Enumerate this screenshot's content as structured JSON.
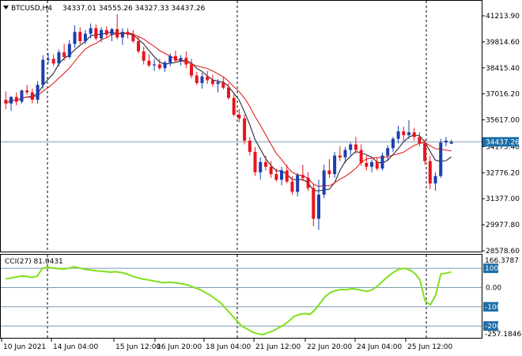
{
  "header": {
    "symbol_timeframe": "BTCUSD,H4",
    "ohlc": "34337.01 34555.26 34327.33 34437.26"
  },
  "cci_panel": {
    "label": "CCI(27) 81.0431",
    "upper_value": "166.3787",
    "lower_value": "-257.1846",
    "level_100": "100",
    "level_0": "0.00",
    "level_m100": "-100",
    "level_m200": "-200"
  },
  "price_axis": {
    "ticks": [
      "41213.90",
      "39814.60",
      "38415.40",
      "37016.20",
      "35617.00",
      "34175.40",
      "32776.20",
      "31377.00",
      "29977.80",
      "28578.60"
    ],
    "current_price_tag": "34437.26"
  },
  "time_axis": {
    "labels": [
      "10 Jun 2021",
      "14 Jun 04:00",
      "15 Jun 12:00",
      "16 Jun 20:00",
      "18 Jun 04:00",
      "21 Jun 12:00",
      "22 Jun 20:00",
      "24 Jun 04:00",
      "25 Jun 12:00"
    ]
  },
  "colors": {
    "bull": "#1a3fae",
    "bear": "#e8141e",
    "band_upper_red": "#e00010",
    "band_lower_blue": "#1010d0",
    "ma_black": "#101828",
    "ma_red": "#e01010",
    "cci_line": "#7fe01a",
    "grid_dash": "#000000",
    "level_line": "#7a9bb5",
    "price_line": "#7a9bb5",
    "tag_bg": "#1a6ea8"
  },
  "chart_data": {
    "type": "candlestick",
    "title": "BTCUSD,H4",
    "ylim": [
      28578.6,
      41213.9
    ],
    "candles": [
      {
        "o": 36700,
        "h": 37150,
        "l": 36200,
        "c": 36500
      },
      {
        "o": 36500,
        "h": 36900,
        "l": 36100,
        "c": 36850
      },
      {
        "o": 36850,
        "h": 37100,
        "l": 36400,
        "c": 36600
      },
      {
        "o": 36600,
        "h": 37250,
        "l": 36500,
        "c": 37200
      },
      {
        "o": 37200,
        "h": 37500,
        "l": 36950,
        "c": 37100
      },
      {
        "o": 37100,
        "h": 37300,
        "l": 36500,
        "c": 36700
      },
      {
        "o": 36700,
        "h": 37700,
        "l": 36500,
        "c": 37500
      },
      {
        "o": 37500,
        "h": 39100,
        "l": 37300,
        "c": 38850
      },
      {
        "o": 38850,
        "h": 39200,
        "l": 38650,
        "c": 38900
      },
      {
        "o": 38900,
        "h": 39150,
        "l": 38500,
        "c": 38650
      },
      {
        "o": 38650,
        "h": 39400,
        "l": 38500,
        "c": 39250
      },
      {
        "o": 39250,
        "h": 39700,
        "l": 38800,
        "c": 39000
      },
      {
        "o": 39000,
        "h": 39900,
        "l": 38900,
        "c": 39700
      },
      {
        "o": 39700,
        "h": 40700,
        "l": 39500,
        "c": 40350
      },
      {
        "o": 40350,
        "h": 40600,
        "l": 39700,
        "c": 39850
      },
      {
        "o": 39850,
        "h": 40450,
        "l": 39700,
        "c": 40250
      },
      {
        "o": 40250,
        "h": 40800,
        "l": 40000,
        "c": 40550
      },
      {
        "o": 40550,
        "h": 40750,
        "l": 39900,
        "c": 40000
      },
      {
        "o": 40000,
        "h": 40600,
        "l": 39800,
        "c": 40450
      },
      {
        "o": 40450,
        "h": 40650,
        "l": 40050,
        "c": 40200
      },
      {
        "o": 40200,
        "h": 40550,
        "l": 39850,
        "c": 40500
      },
      {
        "o": 40500,
        "h": 41300,
        "l": 39950,
        "c": 40050
      },
      {
        "o": 40050,
        "h": 40550,
        "l": 39650,
        "c": 40350
      },
      {
        "o": 40350,
        "h": 40550,
        "l": 40000,
        "c": 40200
      },
      {
        "o": 40200,
        "h": 40450,
        "l": 39750,
        "c": 39850
      },
      {
        "o": 39850,
        "h": 40150,
        "l": 39200,
        "c": 39300
      },
      {
        "o": 39300,
        "h": 39550,
        "l": 38600,
        "c": 38800
      },
      {
        "o": 38800,
        "h": 39150,
        "l": 38450,
        "c": 38550
      },
      {
        "o": 38550,
        "h": 38900,
        "l": 38250,
        "c": 38600
      },
      {
        "o": 38600,
        "h": 38900,
        "l": 38300,
        "c": 38400
      },
      {
        "o": 38400,
        "h": 38800,
        "l": 38200,
        "c": 38700
      },
      {
        "o": 38700,
        "h": 39200,
        "l": 38500,
        "c": 39050
      },
      {
        "o": 39050,
        "h": 39350,
        "l": 38700,
        "c": 38800
      },
      {
        "o": 38800,
        "h": 39100,
        "l": 38550,
        "c": 38950
      },
      {
        "o": 38950,
        "h": 39300,
        "l": 38400,
        "c": 38600
      },
      {
        "o": 38600,
        "h": 38900,
        "l": 37850,
        "c": 38000
      },
      {
        "o": 38000,
        "h": 38200,
        "l": 37500,
        "c": 37600
      },
      {
        "o": 37600,
        "h": 38150,
        "l": 37300,
        "c": 37950
      },
      {
        "o": 37950,
        "h": 38250,
        "l": 37550,
        "c": 37750
      },
      {
        "o": 37750,
        "h": 38050,
        "l": 37400,
        "c": 37550
      },
      {
        "o": 37550,
        "h": 37800,
        "l": 37100,
        "c": 37650
      },
      {
        "o": 37650,
        "h": 37950,
        "l": 37250,
        "c": 37350
      },
      {
        "o": 37350,
        "h": 37600,
        "l": 36700,
        "c": 36800
      },
      {
        "o": 36800,
        "h": 37000,
        "l": 35800,
        "c": 35900
      },
      {
        "o": 35900,
        "h": 36200,
        "l": 35500,
        "c": 35700
      },
      {
        "o": 35700,
        "h": 35900,
        "l": 34300,
        "c": 34500
      },
      {
        "o": 34500,
        "h": 34700,
        "l": 33700,
        "c": 33900
      },
      {
        "o": 33900,
        "h": 34150,
        "l": 32600,
        "c": 32800
      },
      {
        "o": 32800,
        "h": 33600,
        "l": 32400,
        "c": 33350
      },
      {
        "o": 33350,
        "h": 33700,
        "l": 32900,
        "c": 33100
      },
      {
        "o": 33100,
        "h": 33400,
        "l": 32500,
        "c": 32700
      },
      {
        "o": 32700,
        "h": 33000,
        "l": 32300,
        "c": 32400
      },
      {
        "o": 32400,
        "h": 33100,
        "l": 32100,
        "c": 32900
      },
      {
        "o": 32900,
        "h": 33200,
        "l": 32200,
        "c": 32300
      },
      {
        "o": 32300,
        "h": 32600,
        "l": 31600,
        "c": 31750
      },
      {
        "o": 31750,
        "h": 32750,
        "l": 31500,
        "c": 32650
      },
      {
        "o": 32650,
        "h": 33200,
        "l": 32300,
        "c": 32500
      },
      {
        "o": 32500,
        "h": 32800,
        "l": 31800,
        "c": 31950
      },
      {
        "o": 31950,
        "h": 32200,
        "l": 29900,
        "c": 30300
      },
      {
        "o": 30300,
        "h": 32400,
        "l": 29700,
        "c": 31600
      },
      {
        "o": 31600,
        "h": 33200,
        "l": 31400,
        "c": 32900
      },
      {
        "o": 32900,
        "h": 33500,
        "l": 32500,
        "c": 32700
      },
      {
        "o": 32700,
        "h": 33900,
        "l": 32500,
        "c": 33700
      },
      {
        "o": 33700,
        "h": 34200,
        "l": 33400,
        "c": 33600
      },
      {
        "o": 33600,
        "h": 34150,
        "l": 33300,
        "c": 34000
      },
      {
        "o": 34000,
        "h": 34400,
        "l": 33700,
        "c": 34300
      },
      {
        "o": 34300,
        "h": 34700,
        "l": 33800,
        "c": 34000
      },
      {
        "o": 34000,
        "h": 34300,
        "l": 33150,
        "c": 33300
      },
      {
        "o": 33300,
        "h": 33700,
        "l": 32900,
        "c": 33100
      },
      {
        "o": 33100,
        "h": 33500,
        "l": 32800,
        "c": 33350
      },
      {
        "o": 33350,
        "h": 33600,
        "l": 32900,
        "c": 33000
      },
      {
        "o": 33000,
        "h": 33850,
        "l": 32900,
        "c": 33700
      },
      {
        "o": 33700,
        "h": 34250,
        "l": 33400,
        "c": 34100
      },
      {
        "o": 34100,
        "h": 34700,
        "l": 33900,
        "c": 34600
      },
      {
        "o": 34600,
        "h": 35300,
        "l": 34350,
        "c": 35000
      },
      {
        "o": 35000,
        "h": 35250,
        "l": 34500,
        "c": 34800
      },
      {
        "o": 34800,
        "h": 35600,
        "l": 34600,
        "c": 34950
      },
      {
        "o": 34950,
        "h": 35200,
        "l": 34500,
        "c": 34700
      },
      {
        "o": 34700,
        "h": 34950,
        "l": 34200,
        "c": 34350
      },
      {
        "o": 34350,
        "h": 34550,
        "l": 33200,
        "c": 33400
      },
      {
        "o": 33400,
        "h": 33700,
        "l": 31900,
        "c": 32200
      },
      {
        "o": 32200,
        "h": 32800,
        "l": 31800,
        "c": 32600
      },
      {
        "o": 32600,
        "h": 34600,
        "l": 32500,
        "c": 34400
      },
      {
        "o": 34400,
        "h": 34700,
        "l": 34200,
        "c": 34500
      },
      {
        "o": 34337.01,
        "h": 34555.26,
        "l": 34327.33,
        "c": 34437.26
      }
    ],
    "cci": [
      45,
      50,
      55,
      60,
      58,
      52,
      60,
      100,
      105,
      102,
      98,
      96,
      100,
      108,
      102,
      95,
      92,
      88,
      85,
      83,
      80,
      82,
      78,
      72,
      60,
      52,
      45,
      40,
      35,
      30,
      25,
      28,
      26,
      22,
      18,
      10,
      0,
      -10,
      -25,
      -40,
      -60,
      -80,
      -110,
      -140,
      -170,
      -200,
      -215,
      -230,
      -240,
      -245,
      -235,
      -225,
      -210,
      -195,
      -175,
      -150,
      -140,
      -135,
      -140,
      -115,
      -80,
      -45,
      -25,
      -15,
      -10,
      -12,
      -5,
      -10,
      -15,
      -20,
      -10,
      10,
      35,
      60,
      80,
      95,
      100,
      92,
      75,
      40,
      -70,
      -90,
      -40,
      70,
      75,
      81.0431
    ],
    "cci_ylim": [
      -257.1846,
      166.3787
    ],
    "cci_levels": [
      100,
      0,
      -100,
      -200
    ]
  }
}
